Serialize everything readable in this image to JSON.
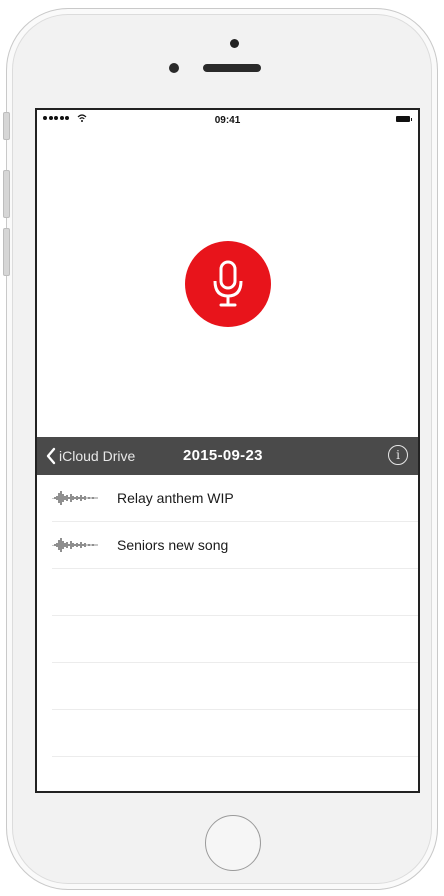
{
  "status_bar": {
    "time": "09:41"
  },
  "nav": {
    "back_label": "iCloud Drive",
    "title": "2015-09-23",
    "info_symbol": "i"
  },
  "recordings": [
    {
      "title": "Relay anthem WIP"
    },
    {
      "title": "Seniors new song"
    }
  ],
  "colors": {
    "record": "#e8141b",
    "navbar": "#4a4a4a"
  },
  "icons": {
    "record": "microphone-icon",
    "back": "chevron-left-icon",
    "info": "info-icon",
    "recording": "waveform-icon"
  }
}
